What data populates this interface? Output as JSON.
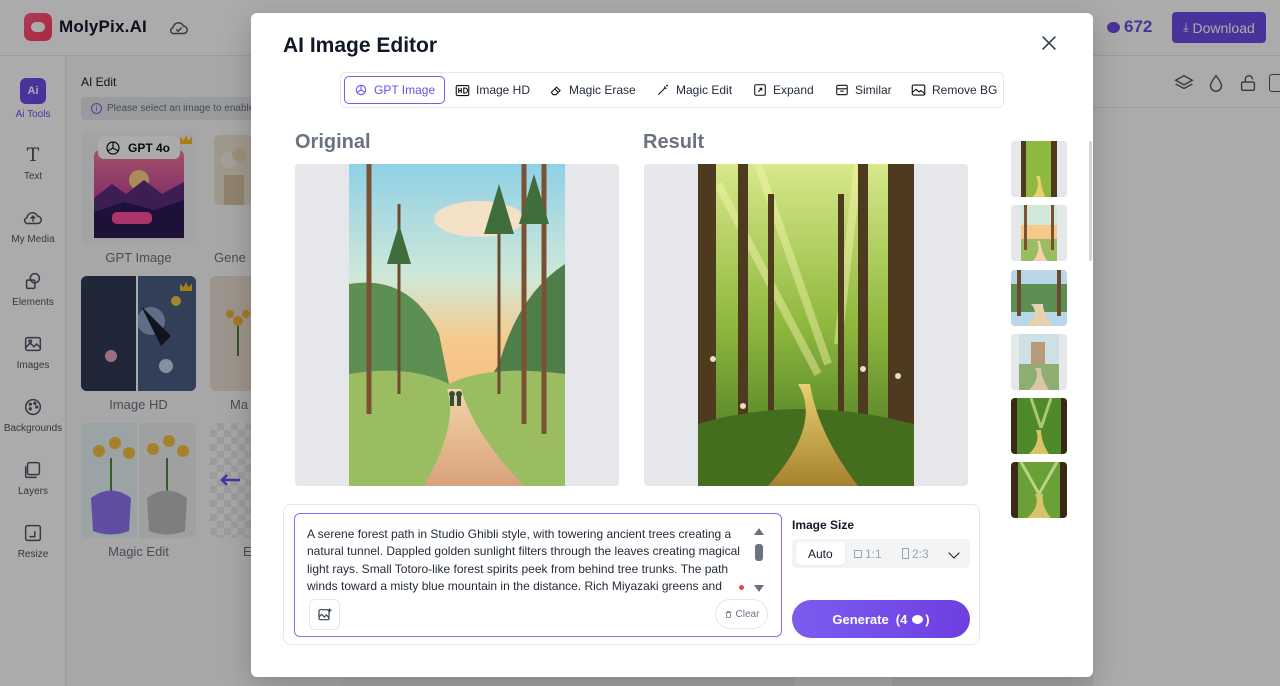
{
  "app": {
    "name": "MolyPix.AI",
    "credits": "672",
    "download_label": "Download"
  },
  "rail": [
    {
      "label": "Ai Tools"
    },
    {
      "label": "Text"
    },
    {
      "label": "My Media"
    },
    {
      "label": "Elements"
    },
    {
      "label": "Images"
    },
    {
      "label": "Backgrounds"
    },
    {
      "label": "Layers"
    },
    {
      "label": "Resize"
    }
  ],
  "panel": {
    "title": "AI Edit",
    "notice": "Please select an image to enable",
    "gpt_badge": "GPT 4o",
    "tools": [
      "GPT Image",
      "Gene",
      "Image HD",
      "Ma",
      "Magic Edit",
      "E"
    ]
  },
  "editor": {
    "title": "AI Image Editor",
    "tabs": [
      "GPT Image",
      "Image HD",
      "Magic Erase",
      "Magic Edit",
      "Expand",
      "Similar",
      "Remove BG"
    ],
    "original_label": "Original",
    "result_label": "Result",
    "prompt": "A serene forest path in Studio Ghibli style, with towering ancient trees creating a natural tunnel. Dappled golden sunlight filters through the leaves creating magical light rays. Small Totoro-like forest spirits peek from behind tree trunks. The path winds toward a misty blue mountain in the distance. Rich Miyazaki greens and",
    "clear_label": "Clear",
    "image_size_label": "Image Size",
    "size_options": [
      "Auto",
      "1:1",
      "2:3"
    ],
    "generate_label": "Generate",
    "generate_cost": "(4",
    "generate_close": ")"
  },
  "colors": {
    "accent": "#6d4de6",
    "accent_light": "#7c5cf0"
  }
}
